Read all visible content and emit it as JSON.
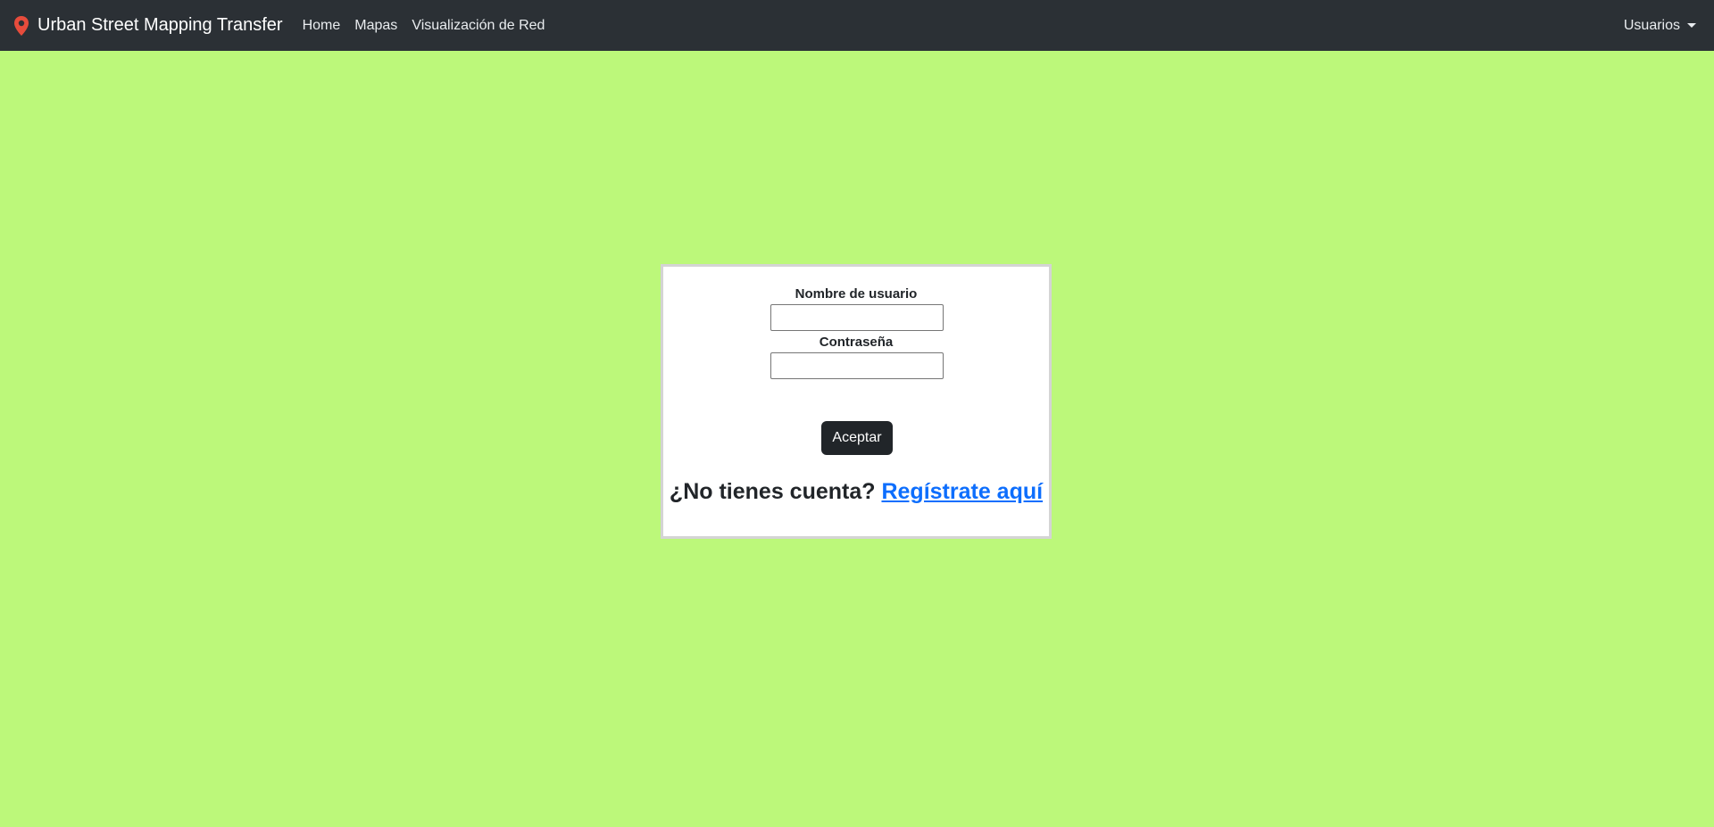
{
  "navbar": {
    "brand": "Urban Street Mapping Transfer",
    "brand_icon": "map-pin-icon",
    "brand_icon_color": "#e74c3c",
    "links": [
      "Home",
      "Mapas",
      "Visualización de Red"
    ],
    "user_menu": "Usuarios"
  },
  "login": {
    "username_label": "Nombre de usuario",
    "username_value": "",
    "password_label": "Contraseña",
    "password_value": "",
    "submit_label": "Aceptar",
    "register_prompt": "¿No tienes cuenta?",
    "register_link": "Regístrate aquí"
  },
  "colors": {
    "background": "#bcf87a",
    "navbar": "#2b3035",
    "link": "#0d6efd",
    "button": "#212529"
  }
}
